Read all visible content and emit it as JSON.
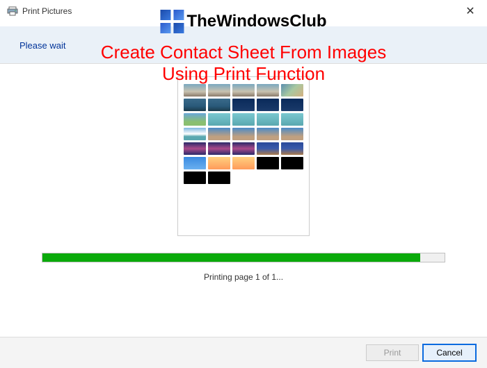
{
  "window": {
    "title": "Print Pictures",
    "close_glyph": "✕"
  },
  "watermark": {
    "text": "TheWindowsClub"
  },
  "overlay": {
    "line1": "Create Contact Sheet From Images",
    "line2": "Using Print Function"
  },
  "header": {
    "please_wait": "Please wait"
  },
  "progress": {
    "percent": "94",
    "status": "Printing page 1 of 1..."
  },
  "footer": {
    "print_label": "Print",
    "cancel_label": "Cancel"
  }
}
